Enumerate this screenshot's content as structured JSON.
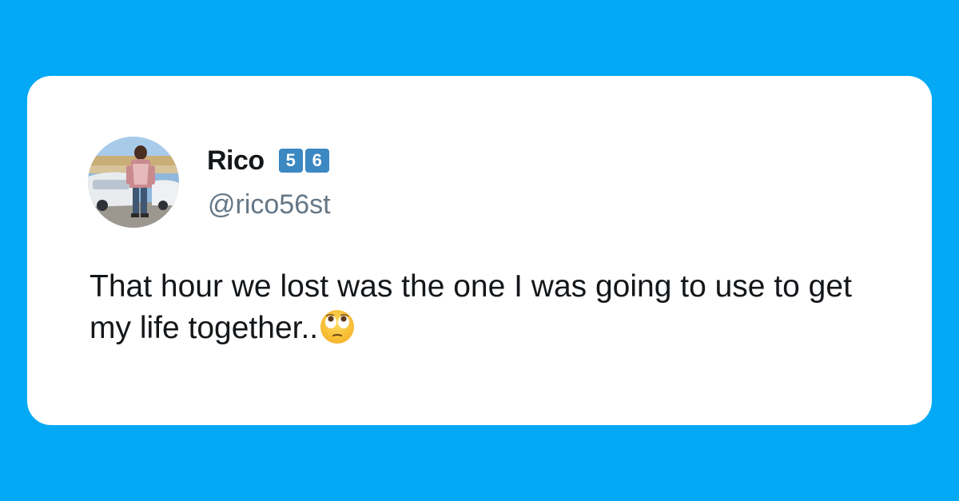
{
  "tweet": {
    "author": {
      "name": "Rico",
      "badges": [
        "5",
        "6"
      ],
      "handle": "@rico56st"
    },
    "text": "That hour we lost was the one I was going to use to get my life together..",
    "emoji": "face-with-rolling-eyes-icon"
  },
  "colors": {
    "background": "#03a9f4",
    "card": "#ffffff",
    "name": "#14171a",
    "handle": "#657786",
    "badge": "#3b88c3"
  }
}
